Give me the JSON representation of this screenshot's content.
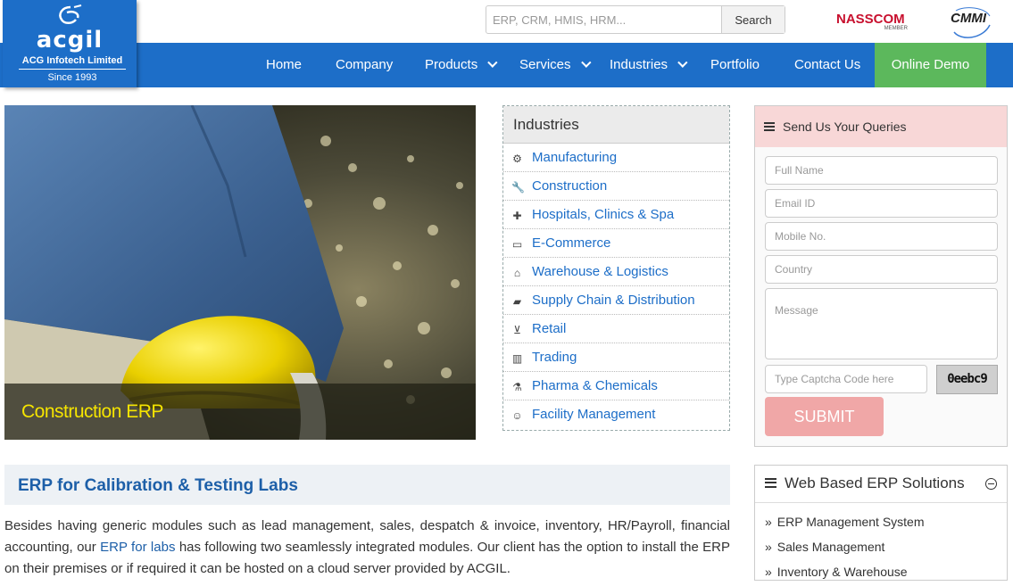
{
  "brand": {
    "name": "acgil",
    "company": "ACG Infotech Limited",
    "since": "Since 1993"
  },
  "search": {
    "placeholder": "ERP, CRM, HMIS, HRM...",
    "button": "Search"
  },
  "badges": {
    "nasscom": "NASSCOM",
    "nasscom_sub": "MEMBER",
    "cmmi": "CMMI"
  },
  "nav": {
    "items": [
      {
        "label": "Home",
        "dropdown": false
      },
      {
        "label": "Company",
        "dropdown": false
      },
      {
        "label": "Products",
        "dropdown": true
      },
      {
        "label": "Services",
        "dropdown": true
      },
      {
        "label": "Industries",
        "dropdown": true
      },
      {
        "label": "Portfolio",
        "dropdown": false
      },
      {
        "label": "Contact Us",
        "dropdown": false
      }
    ],
    "cta": "Online Demo"
  },
  "hero": {
    "caption": "Construction ERP"
  },
  "industries": {
    "title": "Industries",
    "items": [
      {
        "label": "Manufacturing",
        "icon": "cogs-icon"
      },
      {
        "label": "Construction",
        "icon": "wrench-icon"
      },
      {
        "label": "Hospitals, Clinics & Spa",
        "icon": "medkit-icon"
      },
      {
        "label": "E-Commerce",
        "icon": "desktop-icon"
      },
      {
        "label": "Warehouse & Logistics",
        "icon": "home-icon"
      },
      {
        "label": "Supply Chain & Distribution",
        "icon": "truck-icon"
      },
      {
        "label": "Retail",
        "icon": "cart-icon"
      },
      {
        "label": "Trading",
        "icon": "bar-chart-icon"
      },
      {
        "label": "Pharma & Chemicals",
        "icon": "flask-icon"
      },
      {
        "label": "Facility Management",
        "icon": "smile-icon"
      }
    ]
  },
  "queries": {
    "title": "Send Us Your Queries",
    "fields": {
      "full_name": "Full Name",
      "email": "Email ID",
      "mobile": "Mobile No.",
      "country": "Country",
      "message": "Message",
      "captcha": "Type Captcha Code here"
    },
    "captcha_code": "0eebc9",
    "submit": "SUBMIT"
  },
  "article": {
    "title": "ERP for Calibration & Testing Labs",
    "para_before": "Besides having generic modules such as lead management, sales, despatch & invoice, inventory, HR/Payroll, financial accounting, our ",
    "para_link": "ERP for labs",
    "para_after": " has following two seamlessly integrated modules. Our client has the option to install the ERP on their premises or if required it can be hosted on a cloud server provided by ACGIL."
  },
  "web_solutions": {
    "title": "Web Based ERP Solutions",
    "items": [
      "ERP Management System",
      "Sales Management",
      "Inventory & Warehouse"
    ]
  },
  "colors": {
    "primary": "#1d6ec8",
    "demo": "#5cb85c",
    "submit": "#f0a7a7",
    "caption": "#f5e400"
  }
}
